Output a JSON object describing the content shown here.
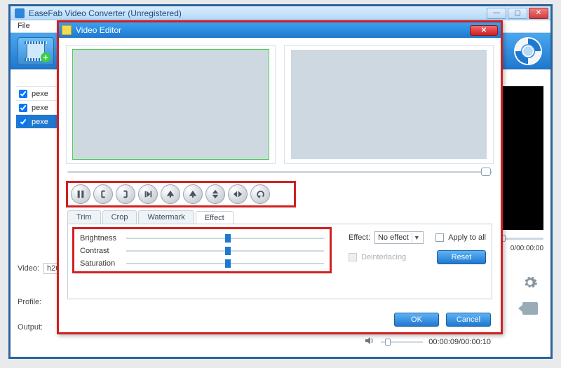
{
  "app": {
    "title": "EaseFab Video Converter (Unregistered)",
    "menu_file": "File",
    "win": {
      "min": "—",
      "max": "▢",
      "close": "✕"
    }
  },
  "filelist": {
    "items": [
      "pexe",
      "pexe",
      "pexe"
    ],
    "selected_index": 2
  },
  "labels": {
    "video": "Video:",
    "video_value": "h26",
    "profile": "Profile:",
    "output": "Output:"
  },
  "right_preview": {
    "time": "0/00:00:00"
  },
  "dialog": {
    "title": "Video Editor",
    "time_display": "00:00:09/00:00:10",
    "tabs": [
      "Trim",
      "Crop",
      "Watermark",
      "Effect"
    ],
    "active_tab": 3,
    "fx": {
      "brightness_label": "Brightness",
      "contrast_label": "Contrast",
      "saturation_label": "Saturation",
      "brightness": 50,
      "contrast": 50,
      "saturation": 50
    },
    "effect_label": "Effect:",
    "effect_value": "No effect",
    "apply_all_label": "Apply to all",
    "deinterlacing_label": "Deinterlacing",
    "reset_label": "Reset",
    "ok_label": "OK",
    "cancel_label": "Cancel"
  },
  "icons": {
    "transport": [
      "pause",
      "mark-in",
      "mark-out",
      "step",
      "rotate-ccw",
      "rotate-cw",
      "flip-v",
      "flip-h",
      "undo"
    ]
  },
  "colors": {
    "accent": "#1f78cf",
    "highlight": "#d12020"
  }
}
